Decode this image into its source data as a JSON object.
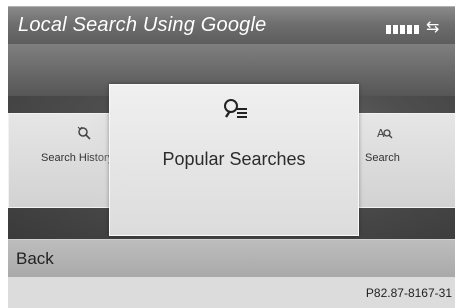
{
  "header": {
    "title": "Local Search Using Google",
    "signal_icon": "signal-strength-icon",
    "transfer_icon": "data-transfer-icon",
    "transfer_glyph": "⇆"
  },
  "menu": {
    "items": [
      {
        "label": "Search History",
        "icon": "search-history-icon"
      },
      {
        "label": "Popular Searches",
        "icon": "popular-searches-icon",
        "selected": true
      },
      {
        "label": "Search",
        "icon": "search-icon"
      }
    ]
  },
  "footer": {
    "back_label": "Back",
    "reference": "P82.87-8167-31"
  }
}
